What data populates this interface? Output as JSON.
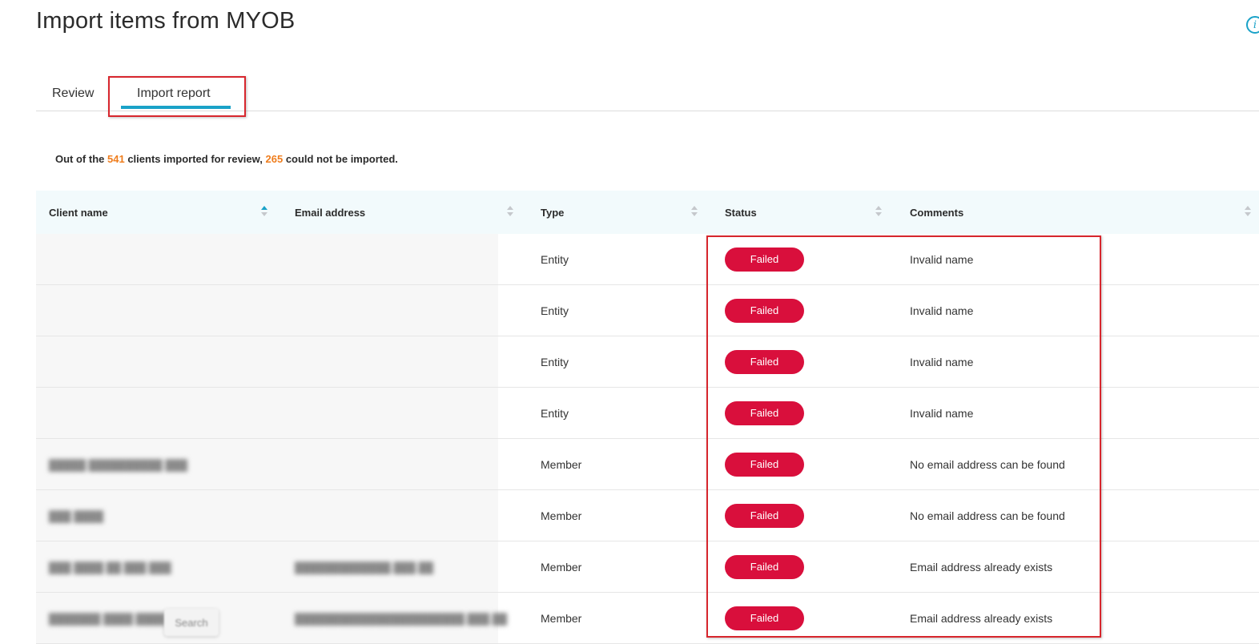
{
  "page": {
    "title": "Import items from MYOB"
  },
  "tabs": [
    {
      "label": "Review",
      "active": false
    },
    {
      "label": "Import report",
      "active": true
    }
  ],
  "summary": {
    "prefix": "Out of the ",
    "total": "541",
    "middle": " clients imported for review, ",
    "failed": "265",
    "suffix": " could not be imported."
  },
  "table": {
    "columns": [
      "Client name",
      "Email address",
      "Type",
      "Status",
      "Comments"
    ],
    "rows": [
      {
        "client": "",
        "email": "",
        "type": "Entity",
        "status": "Failed",
        "comment": "Invalid name"
      },
      {
        "client": "",
        "email": "",
        "type": "Entity",
        "status": "Failed",
        "comment": "Invalid name"
      },
      {
        "client": "",
        "email": "",
        "type": "Entity",
        "status": "Failed",
        "comment": "Invalid name"
      },
      {
        "client": "",
        "email": "",
        "type": "Entity",
        "status": "Failed",
        "comment": "Invalid name"
      },
      {
        "client": "",
        "email": "",
        "type": "Member",
        "status": "Failed",
        "comment": "No email address can be found"
      },
      {
        "client": "",
        "email": "",
        "type": "Member",
        "status": "Failed",
        "comment": "No email address can be found"
      },
      {
        "client": "",
        "email": "",
        "type": "Member",
        "status": "Failed",
        "comment": "Email address already exists"
      },
      {
        "client": "",
        "email": "",
        "type": "Member",
        "status": "Failed",
        "comment": "Email address already exists"
      }
    ]
  },
  "tooltip": {
    "label": "Search"
  },
  "colors": {
    "accent": "#1aa2c8",
    "failed_badge": "#d90f3c",
    "highlight": "#d7262d",
    "summary_number": "#ef7d1d"
  }
}
